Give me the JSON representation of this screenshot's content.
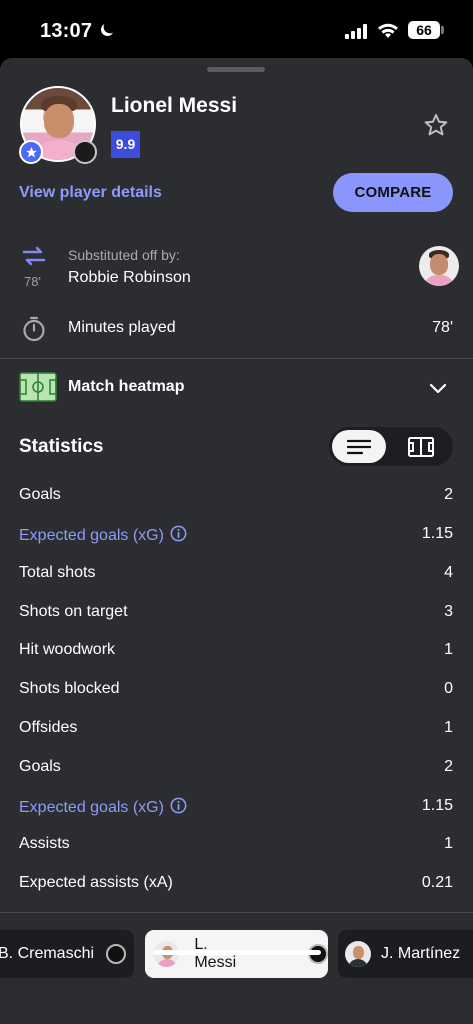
{
  "status_bar": {
    "time": "13:07",
    "battery": "66"
  },
  "player": {
    "name": "Lionel Messi",
    "rating": "9.9",
    "view_details": "View player details",
    "compare": "COMPARE"
  },
  "substitution": {
    "minute": "78'",
    "label": "Substituted off by:",
    "name": "Robbie Robinson"
  },
  "minutes": {
    "label": "Minutes played",
    "value": "78'"
  },
  "heatmap": {
    "label": "Match heatmap"
  },
  "statistics": {
    "title": "Statistics",
    "rows": [
      {
        "label": "Goals",
        "value": "2"
      },
      {
        "label": "Expected goals (xG)",
        "value": "1.15"
      },
      {
        "label": "Total shots",
        "value": "4"
      },
      {
        "label": "Shots on target",
        "value": "3"
      },
      {
        "label": "Hit woodwork",
        "value": "1"
      },
      {
        "label": "Shots blocked",
        "value": "0"
      },
      {
        "label": "Offsides",
        "value": "1"
      },
      {
        "label": "Goals",
        "value": "2"
      },
      {
        "label": "Expected goals (xG)",
        "value": "1.15"
      },
      {
        "label": "Assists",
        "value": "1"
      },
      {
        "label": "Expected assists (xA)",
        "value": "0.21"
      }
    ]
  },
  "carousel": [
    {
      "name": "B. Cremaschi"
    },
    {
      "name": "L. Messi"
    },
    {
      "name": "J. Martínez"
    }
  ],
  "colors": {
    "accent": "#8a96fb",
    "link": "#8f9bf9",
    "rating_bg": "#3c4dde",
    "sheet_bg": "#2c2d31"
  }
}
